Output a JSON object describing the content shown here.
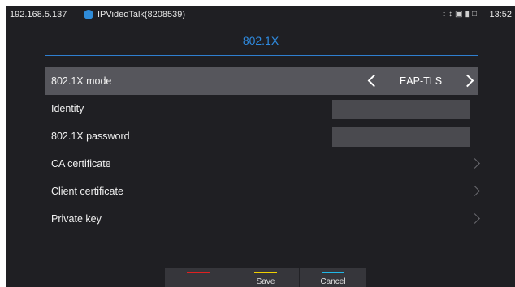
{
  "status_bar": {
    "ip": "192.168.5.137",
    "app": "IPVideoTalk(8208539)",
    "icons": [
      "usb-icon",
      "usb-icon",
      "image-icon",
      "sd-card-icon",
      "screen-icon"
    ],
    "time": "13:52"
  },
  "title": "802.1X",
  "settings": {
    "mode": {
      "label": "802.1X mode",
      "value": "EAP-TLS"
    },
    "identity": {
      "label": "Identity",
      "value": ""
    },
    "password": {
      "label": "802.1X password",
      "value": ""
    },
    "ca_cert": {
      "label": "CA certificate"
    },
    "client_cert": {
      "label": "Client certificate"
    },
    "private_key": {
      "label": "Private key"
    }
  },
  "softkeys": {
    "red": {
      "label": "",
      "color": "#e02020"
    },
    "save": {
      "label": "Save",
      "color": "#f0d000"
    },
    "cancel": {
      "label": "Cancel",
      "color": "#20b8e8"
    }
  },
  "colors": {
    "accent": "#2f8be0",
    "highlight_row": "#56565c",
    "background": "#1f1f23"
  }
}
